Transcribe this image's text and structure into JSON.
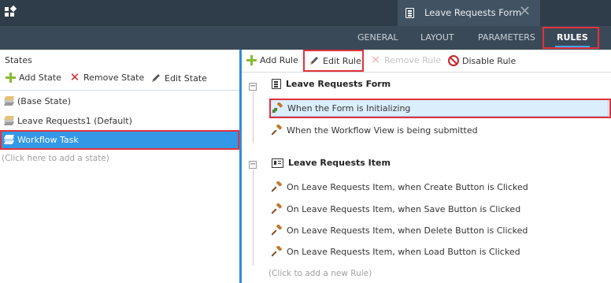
{
  "header": {
    "document_tab": "Leave Requests Form",
    "nav_tabs": [
      "GENERAL",
      "LAYOUT",
      "PARAMETERS",
      "RULES"
    ],
    "active_tab": "RULES"
  },
  "states_panel": {
    "title": "States",
    "toolbar": {
      "add_label": "Add State",
      "remove_label": "Remove State",
      "edit_label": "Edit State"
    },
    "items": [
      {
        "label": "(Base State)"
      },
      {
        "label": "Leave Requests1 (Default)"
      },
      {
        "label": "Workflow Task"
      }
    ],
    "selected": "Workflow Task",
    "add_placeholder": "(Click here to add a state)"
  },
  "rules_panel": {
    "toolbar": {
      "add_label": "Add Rule",
      "edit_label": "Edit Rule",
      "remove_label": "Remove Rule",
      "disable_label": "Disable Rule"
    },
    "groups": [
      {
        "title": "Leave Requests Form",
        "rules": [
          "When the Form is Initializing",
          "When the Workflow View is being submitted"
        ]
      },
      {
        "title": "Leave Requests Item",
        "rules": [
          "On Leave Requests Item, when Create Button is Clicked",
          "On Leave Requests Item, when Save Button is Clicked",
          "On Leave Requests Item, when Delete Button is Clicked",
          "On Leave Requests Item, when Load Button is Clicked"
        ]
      }
    ],
    "selected_rule": "When the Form is Initializing",
    "add_placeholder": "(Click to add a new Rule)"
  },
  "colors": {
    "header_bg": "#2f3d4a",
    "nav_bg": "#3a4957",
    "accent_blue": "#3399e6",
    "highlight_red": "#e2323c",
    "add_green": "#8ab933"
  }
}
